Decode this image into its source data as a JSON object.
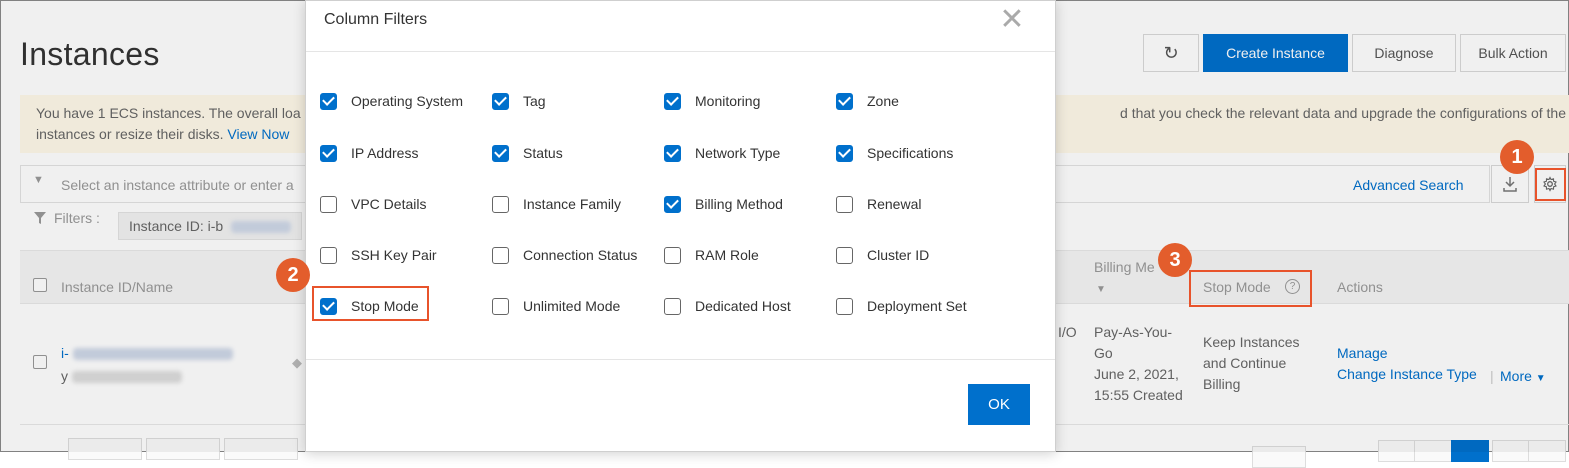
{
  "page": {
    "title": "Instances",
    "toolbar": {
      "create_label": "Create Instance",
      "diagnose_label": "Diagnose",
      "bulk_label": "Bulk Action"
    },
    "notice": {
      "line1_left": "You have 1 ECS instances. The overall loa",
      "line1_right": "d that you check the relevant data and upgrade the configurations of the",
      "line2": "instances or resize their disks.",
      "link": "View Now"
    },
    "search": {
      "placeholder": "Select an instance attribute or enter a",
      "advanced_label": "Advanced Search"
    },
    "filters": {
      "label": "Filters :",
      "chip": "Instance ID: i-b"
    },
    "table": {
      "headers": {
        "instance": "Instance ID/Name",
        "billing": "Billing Me",
        "stop_mode": "Stop Mode",
        "actions": "Actions"
      },
      "row": {
        "id_prefix": "i-",
        "name_prefix": "y",
        "io_fragment": "I/O",
        "billing": [
          "Pay-As-You-",
          "Go",
          "June 2, 2021,",
          "15:55 Created"
        ],
        "stop_mode": [
          "Keep Instances",
          "and Continue",
          "Billing"
        ],
        "manage": "Manage",
        "change_type": "Change Instance Type",
        "separator": "|",
        "more": "More"
      }
    }
  },
  "modal": {
    "title": "Column Filters",
    "ok_label": "OK",
    "options": [
      {
        "label": "Operating System",
        "checked": true
      },
      {
        "label": "Tag",
        "checked": true
      },
      {
        "label": "Monitoring",
        "checked": true
      },
      {
        "label": "Zone",
        "checked": true
      },
      {
        "label": "IP Address",
        "checked": true
      },
      {
        "label": "Status",
        "checked": true
      },
      {
        "label": "Network Type",
        "checked": true
      },
      {
        "label": "Specifications",
        "checked": true
      },
      {
        "label": "VPC Details",
        "checked": false
      },
      {
        "label": "Instance Family",
        "checked": false
      },
      {
        "label": "Billing Method",
        "checked": true
      },
      {
        "label": "Renewal",
        "checked": false
      },
      {
        "label": "SSH Key Pair",
        "checked": false
      },
      {
        "label": "Connection Status",
        "checked": false
      },
      {
        "label": "RAM Role",
        "checked": false
      },
      {
        "label": "Cluster ID",
        "checked": false
      },
      {
        "label": "Stop Mode",
        "checked": true
      },
      {
        "label": "Unlimited Mode",
        "checked": false
      },
      {
        "label": "Dedicated Host",
        "checked": false
      },
      {
        "label": "Deployment Set",
        "checked": false
      }
    ]
  },
  "callouts": [
    "1",
    "2",
    "3"
  ],
  "colors": {
    "primary": "#0070cc",
    "callout": "#e35d2c",
    "highlight": "#e8532b",
    "notice_bg": "#fff9e9"
  },
  "icons": {
    "refresh": "refresh-icon",
    "download": "download-icon",
    "settings": "gear-icon",
    "close": "close-icon",
    "filter": "funnel-icon",
    "help": "question-circle-icon"
  }
}
